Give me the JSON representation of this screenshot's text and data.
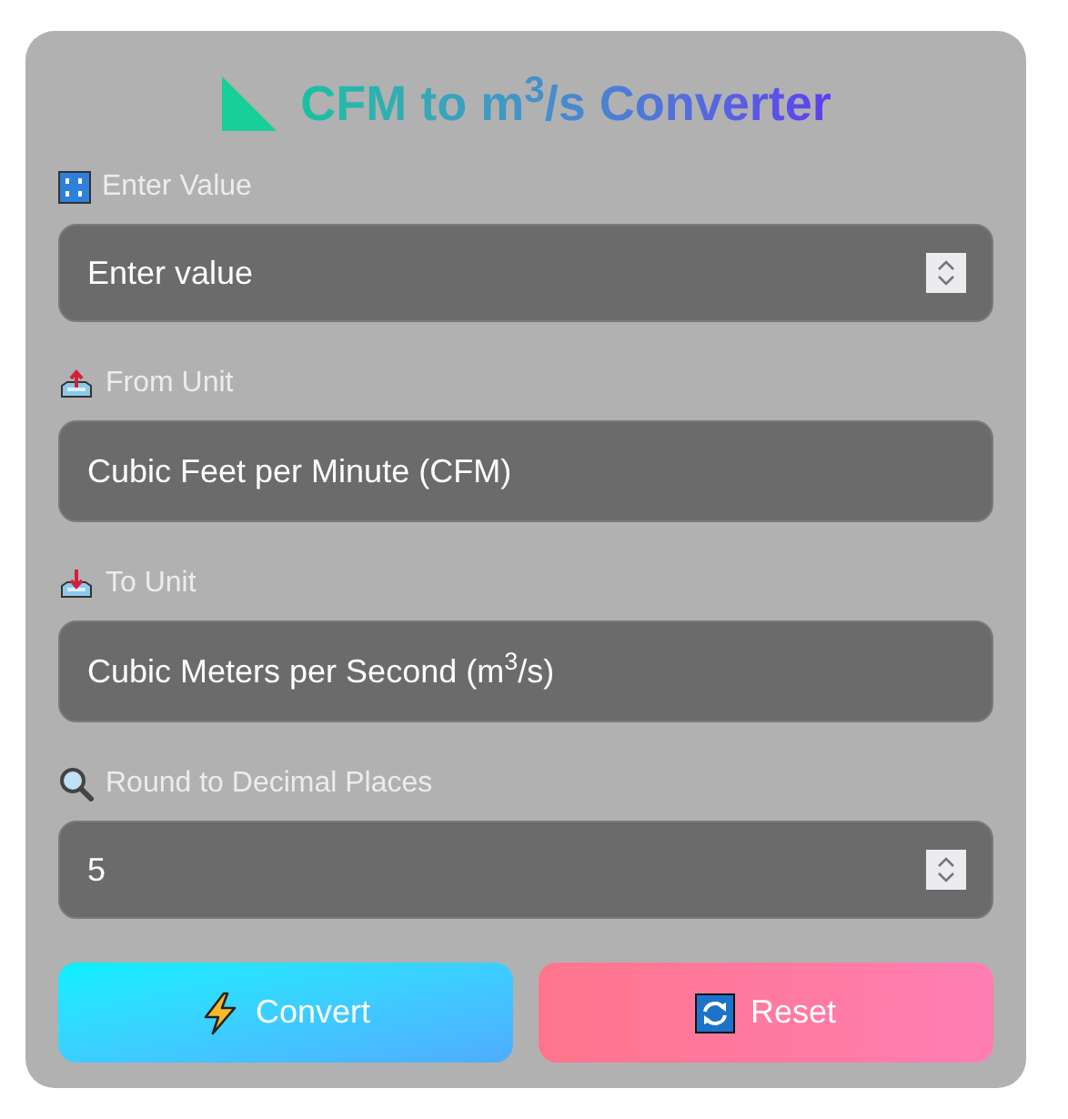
{
  "title": "CFM to m$^{3}$/s Converter",
  "fields": [
    {
      "kind": "number",
      "label": "Enter Value",
      "placeholder": "Enter value"
    },
    {
      "kind": "select",
      "label": "From Unit",
      "value": "Cubic Feet per Minute (CFM)"
    },
    {
      "kind": "select",
      "label": "To Unit",
      "value": "Cubic Meters per Second (m$^{3}$/s)"
    },
    {
      "kind": "number",
      "label": "Round to Decimal Places",
      "value": "5"
    }
  ],
  "buttons": [
    {
      "kind": "convert",
      "label": "Convert"
    },
    {
      "kind": "reset",
      "label": "Reset"
    }
  ]
}
